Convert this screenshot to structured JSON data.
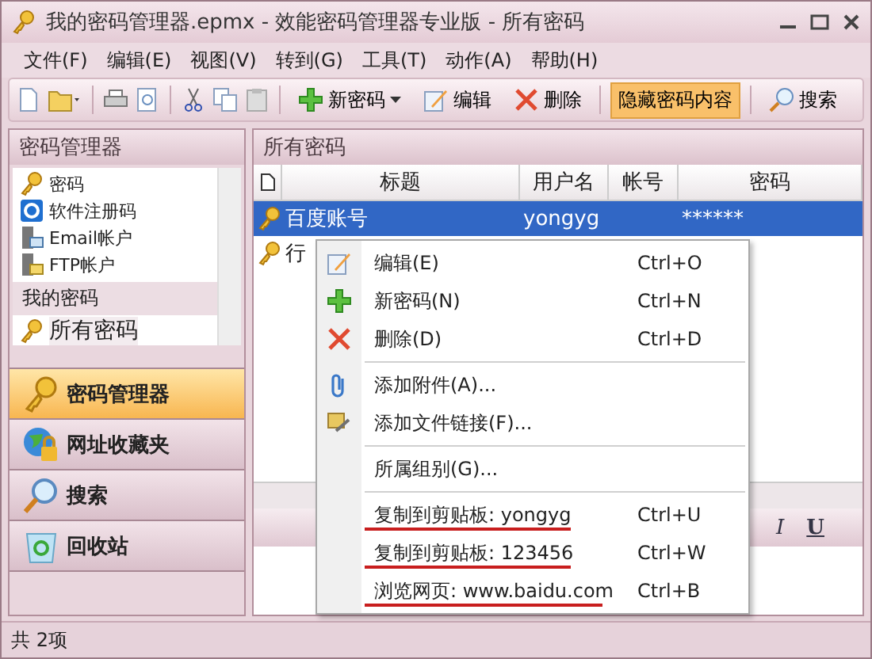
{
  "window": {
    "title": "我的密码管理器.epmx - 效能密码管理器专业版 - 所有密码"
  },
  "menu": [
    "文件(F)",
    "编辑(E)",
    "视图(V)",
    "转到(G)",
    "工具(T)",
    "动作(A)",
    "帮助(H)"
  ],
  "toolbar": [
    {
      "label": "新密码",
      "on": false
    },
    {
      "label": "编辑",
      "on": false
    },
    {
      "label": "删除",
      "on": false
    },
    {
      "label": "隐藏密码内容",
      "on": true
    },
    {
      "label": "搜索",
      "on": false
    }
  ],
  "sidebar": {
    "title": "密码管理器",
    "categories": [
      {
        "label": "密码"
      },
      {
        "label": "软件注册码"
      },
      {
        "label": "Email帐户"
      },
      {
        "label": "FTP帐户"
      }
    ],
    "group": "我的密码",
    "group_items": [
      {
        "label": "所有密码",
        "selected": true
      }
    ],
    "nav": [
      {
        "label": "密码管理器",
        "selected": true
      },
      {
        "label": "网址收藏夹",
        "selected": false
      },
      {
        "label": "搜索",
        "selected": false
      },
      {
        "label": "回收站",
        "selected": false
      }
    ]
  },
  "content": {
    "title": "所有密码",
    "table": {
      "columns": [
        "标题",
        "用户名",
        "帐号",
        "密码"
      ],
      "rows": [
        {
          "cells": [
            "百度账号",
            "yongyg",
            "",
            "******"
          ],
          "selected": true
        },
        {
          "cells": [
            "行",
            "",
            "",
            ""
          ],
          "selected": false
        }
      ]
    },
    "editor_toolbar": [
      "I",
      "U"
    ]
  },
  "context_menu": [
    {
      "kind": "item",
      "label": "编辑(E)",
      "shortcut": "Ctrl+O",
      "underlined": false
    },
    {
      "kind": "item",
      "label": "新密码(N)",
      "shortcut": "Ctrl+N",
      "underlined": false
    },
    {
      "kind": "item",
      "label": "删除(D)",
      "shortcut": "Ctrl+D",
      "underlined": false
    },
    {
      "kind": "separator"
    },
    {
      "kind": "item",
      "label": "添加附件(A)...",
      "underlined": false
    },
    {
      "kind": "item",
      "label": "添加文件链接(F)...",
      "underlined": false
    },
    {
      "kind": "separator"
    },
    {
      "kind": "item",
      "label": "所属组别(G)...",
      "underlined": false
    },
    {
      "kind": "separator"
    },
    {
      "kind": "item",
      "label": "复制到剪贴板: yongyg",
      "shortcut": "Ctrl+U",
      "underlined": true
    },
    {
      "kind": "item",
      "label": "复制到剪贴板: 123456",
      "shortcut": "Ctrl+W",
      "underlined": true
    },
    {
      "kind": "item",
      "label": "浏览网页: www.baidu.com",
      "shortcut": "Ctrl+B",
      "underlined": true
    }
  ],
  "status_bar": "共 2项"
}
